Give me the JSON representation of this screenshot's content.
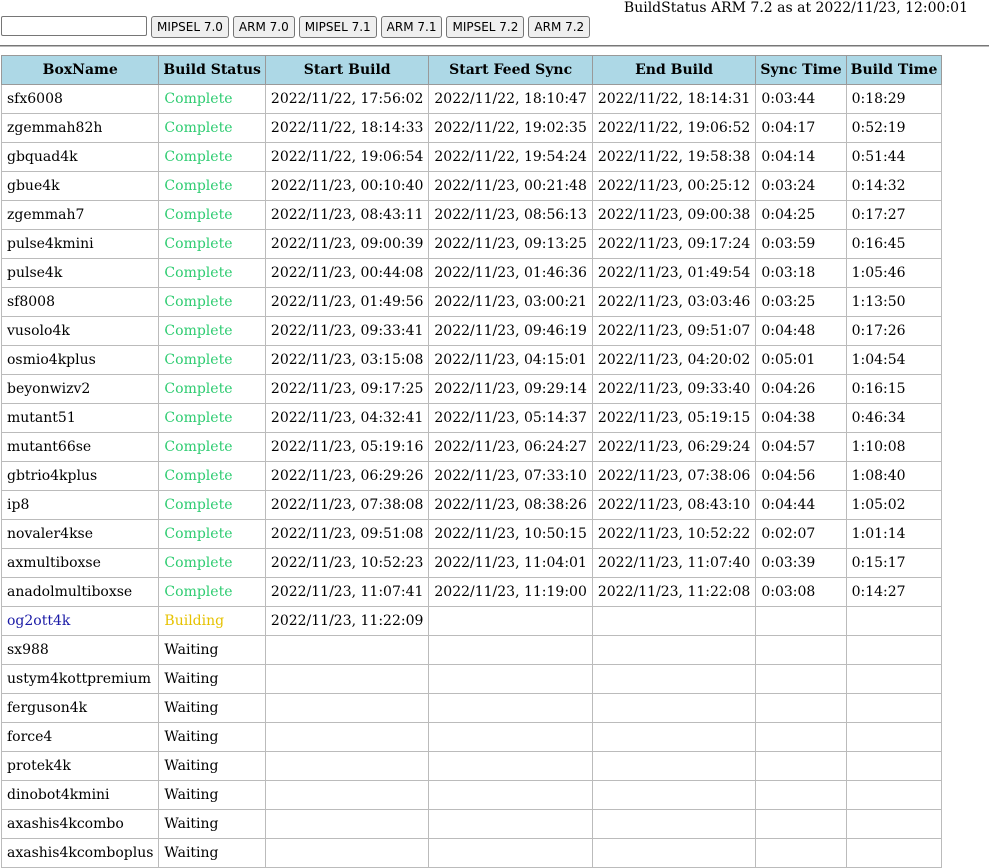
{
  "header": {
    "title": "BuildStatus ARM 7.2 as at 2022/11/23, 12:00:01",
    "search": {
      "value": "",
      "placeholder": ""
    },
    "buttons": [
      "MIPSEL 7.0",
      "ARM 7.0",
      "MIPSEL 7.1",
      "ARM 7.1",
      "MIPSEL 7.2",
      "ARM 7.2"
    ]
  },
  "table": {
    "columns": [
      "BoxName",
      "Build Status",
      "Start Build",
      "Start Feed Sync",
      "End Build",
      "Sync Time",
      "Build Time"
    ],
    "rows": [
      [
        "sfx6008",
        "Complete",
        "2022/11/22, 17:56:02",
        "2022/11/22, 18:10:47",
        "2022/11/22, 18:14:31",
        "0:03:44",
        "0:18:29"
      ],
      [
        "zgemmah82h",
        "Complete",
        "2022/11/22, 18:14:33",
        "2022/11/22, 19:02:35",
        "2022/11/22, 19:06:52",
        "0:04:17",
        "0:52:19"
      ],
      [
        "gbquad4k",
        "Complete",
        "2022/11/22, 19:06:54",
        "2022/11/22, 19:54:24",
        "2022/11/22, 19:58:38",
        "0:04:14",
        "0:51:44"
      ],
      [
        "gbue4k",
        "Complete",
        "2022/11/23, 00:10:40",
        "2022/11/23, 00:21:48",
        "2022/11/23, 00:25:12",
        "0:03:24",
        "0:14:32"
      ],
      [
        "zgemmah7",
        "Complete",
        "2022/11/23, 08:43:11",
        "2022/11/23, 08:56:13",
        "2022/11/23, 09:00:38",
        "0:04:25",
        "0:17:27"
      ],
      [
        "pulse4kmini",
        "Complete",
        "2022/11/23, 09:00:39",
        "2022/11/23, 09:13:25",
        "2022/11/23, 09:17:24",
        "0:03:59",
        "0:16:45"
      ],
      [
        "pulse4k",
        "Complete",
        "2022/11/23, 00:44:08",
        "2022/11/23, 01:46:36",
        "2022/11/23, 01:49:54",
        "0:03:18",
        "1:05:46"
      ],
      [
        "sf8008",
        "Complete",
        "2022/11/23, 01:49:56",
        "2022/11/23, 03:00:21",
        "2022/11/23, 03:03:46",
        "0:03:25",
        "1:13:50"
      ],
      [
        "vusolo4k",
        "Complete",
        "2022/11/23, 09:33:41",
        "2022/11/23, 09:46:19",
        "2022/11/23, 09:51:07",
        "0:04:48",
        "0:17:26"
      ],
      [
        "osmio4kplus",
        "Complete",
        "2022/11/23, 03:15:08",
        "2022/11/23, 04:15:01",
        "2022/11/23, 04:20:02",
        "0:05:01",
        "1:04:54"
      ],
      [
        "beyonwizv2",
        "Complete",
        "2022/11/23, 09:17:25",
        "2022/11/23, 09:29:14",
        "2022/11/23, 09:33:40",
        "0:04:26",
        "0:16:15"
      ],
      [
        "mutant51",
        "Complete",
        "2022/11/23, 04:32:41",
        "2022/11/23, 05:14:37",
        "2022/11/23, 05:19:15",
        "0:04:38",
        "0:46:34"
      ],
      [
        "mutant66se",
        "Complete",
        "2022/11/23, 05:19:16",
        "2022/11/23, 06:24:27",
        "2022/11/23, 06:29:24",
        "0:04:57",
        "1:10:08"
      ],
      [
        "gbtrio4kplus",
        "Complete",
        "2022/11/23, 06:29:26",
        "2022/11/23, 07:33:10",
        "2022/11/23, 07:38:06",
        "0:04:56",
        "1:08:40"
      ],
      [
        "ip8",
        "Complete",
        "2022/11/23, 07:38:08",
        "2022/11/23, 08:38:26",
        "2022/11/23, 08:43:10",
        "0:04:44",
        "1:05:02"
      ],
      [
        "novaler4kse",
        "Complete",
        "2022/11/23, 09:51:08",
        "2022/11/23, 10:50:15",
        "2022/11/23, 10:52:22",
        "0:02:07",
        "1:01:14"
      ],
      [
        "axmultiboxse",
        "Complete",
        "2022/11/23, 10:52:23",
        "2022/11/23, 11:04:01",
        "2022/11/23, 11:07:40",
        "0:03:39",
        "0:15:17"
      ],
      [
        "anadolmultiboxse",
        "Complete",
        "2022/11/23, 11:07:41",
        "2022/11/23, 11:19:00",
        "2022/11/23, 11:22:08",
        "0:03:08",
        "0:14:27"
      ],
      [
        "og2ott4k",
        "Building",
        "2022/11/23, 11:22:09",
        "",
        "",
        "",
        ""
      ],
      [
        "sx988",
        "Waiting",
        "",
        "",
        "",
        "",
        ""
      ],
      [
        "ustym4kottpremium",
        "Waiting",
        "",
        "",
        "",
        "",
        ""
      ],
      [
        "ferguson4k",
        "Waiting",
        "",
        "",
        "",
        "",
        ""
      ],
      [
        "force4",
        "Waiting",
        "",
        "",
        "",
        "",
        ""
      ],
      [
        "protek4k",
        "Waiting",
        "",
        "",
        "",
        "",
        ""
      ],
      [
        "dinobot4kmini",
        "Waiting",
        "",
        "",
        "",
        "",
        ""
      ],
      [
        "axashis4kcombo",
        "Waiting",
        "",
        "",
        "",
        "",
        ""
      ],
      [
        "axashis4kcomboplus",
        "Waiting",
        "",
        "",
        "",
        "",
        ""
      ]
    ]
  },
  "colors": {
    "header_bg": "#add8e6",
    "complete": "#2ecc71",
    "building": "#e6c200",
    "active_box": "#1a1aa6"
  }
}
